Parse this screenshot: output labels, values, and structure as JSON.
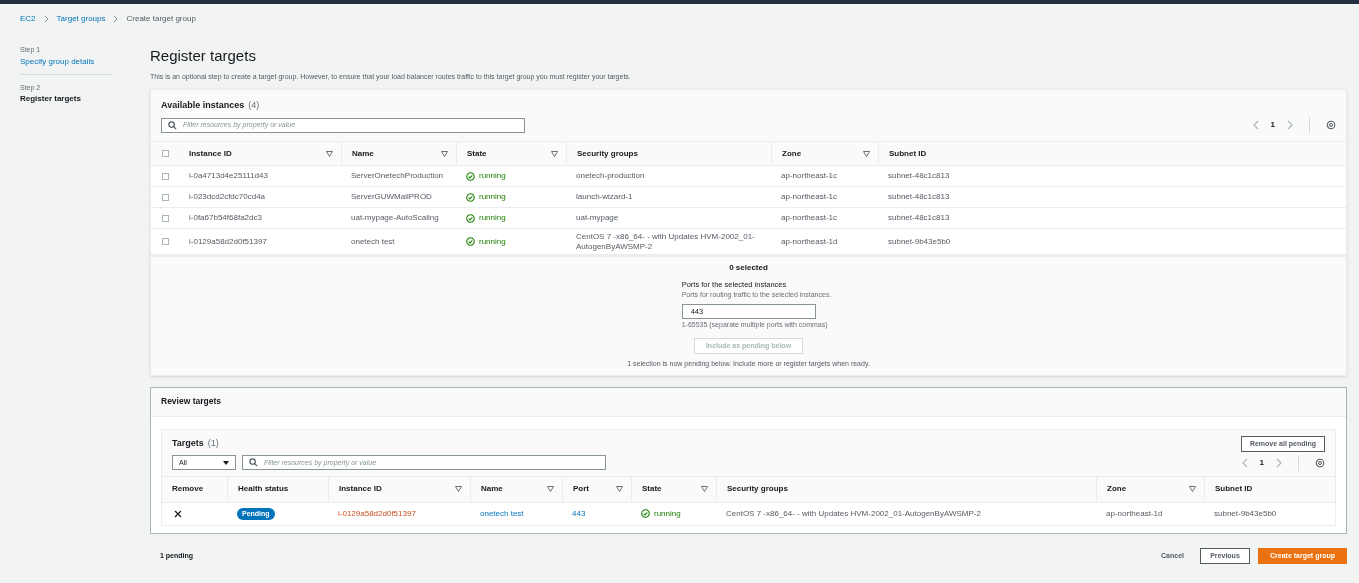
{
  "breadcrumb": [
    {
      "label": "EC2",
      "link": true
    },
    {
      "label": "Target groups",
      "link": true
    },
    {
      "label": "Create target group",
      "link": false
    }
  ],
  "steps": [
    {
      "step": "Step 1",
      "label": "Specify group details",
      "selected": false
    },
    {
      "step": "Step 2",
      "label": "Register targets",
      "selected": true
    }
  ],
  "title": "Register targets",
  "description": "This is an optional step to create a target group. However, to ensure that your load balancer routes traffic to this target group you must register your targets.",
  "available": {
    "title": "Available instances",
    "count": "(4)",
    "search_placeholder": "Filter resources by property or value",
    "page": "1",
    "columns": [
      {
        "label": "Instance ID",
        "sortable": true
      },
      {
        "label": "Name",
        "sortable": true
      },
      {
        "label": "State",
        "sortable": true
      },
      {
        "label": "Security groups",
        "sortable": false
      },
      {
        "label": "Zone",
        "sortable": true
      },
      {
        "label": "Subnet ID",
        "sortable": false
      }
    ],
    "all_checked": false,
    "rows": [
      {
        "checked": false,
        "instance_id": "i-0a4713d4e25111d43",
        "name": "ServerOnetechProduction",
        "state": "running",
        "security_groups": "onetech-production",
        "zone": "ap-northeast-1c",
        "subnet_id": "subnet-48c1c813"
      },
      {
        "checked": false,
        "instance_id": "i-023dcd2cfdc70cd4a",
        "name": "ServerGUWMailPROD",
        "state": "running",
        "security_groups": "launch-wizard-1",
        "zone": "ap-northeast-1c",
        "subnet_id": "subnet-48c1c813"
      },
      {
        "checked": false,
        "instance_id": "i-0fa67b54f68fa2dc3",
        "name": "uat-mypage-AutoScaling",
        "state": "running",
        "security_groups": "uat-mypage",
        "zone": "ap-northeast-1c",
        "subnet_id": "subnet-48c1c813"
      },
      {
        "checked": false,
        "instance_id": "i-0129a58d2d0f51397",
        "name": "onetech test",
        "state": "running",
        "security_groups": "CentOS 7 -x86_64- - with Updates HVM-2002_01-AutogenByAWSMP-2",
        "zone": "ap-northeast-1d",
        "subnet_id": "subnet-9b43e5b0"
      }
    ]
  },
  "selection": {
    "count_text": "0 selected",
    "ports_label": "Ports for the selected instances",
    "ports_hint": "Ports for routing traffic to the selected instances.",
    "ports_value": "443",
    "range_hint": "1-65535 (separate multiple ports with commas)",
    "include_button": {
      "label": "Include as pending below",
      "disabled": true
    },
    "pending_note": "1 selection is now pending below. Include more or register targets when ready."
  },
  "review": {
    "title": "Review targets",
    "targets_title": "Targets",
    "count": "(1)",
    "remove_all": "Remove all pending",
    "filter_value": "All",
    "search_placeholder": "Filter resources by property or value",
    "page": "1",
    "columns": [
      {
        "label": "Remove",
        "sortable": false
      },
      {
        "label": "Health status",
        "sortable": false
      },
      {
        "label": "Instance ID",
        "sortable": true
      },
      {
        "label": "Name",
        "sortable": true
      },
      {
        "label": "Port",
        "sortable": true
      },
      {
        "label": "State",
        "sortable": true
      },
      {
        "label": "Security groups",
        "sortable": false
      },
      {
        "label": "Zone",
        "sortable": true
      },
      {
        "label": "Subnet ID",
        "sortable": false
      }
    ],
    "rows": [
      {
        "health": "Pending",
        "instance_id": "i-0129a58d2d0f51397",
        "name": "onetech test",
        "port": "443",
        "state": "running",
        "security_groups": "CentOS 7 -x86_64- - with Updates HVM-2002_01-AutogenByAWSMP-2",
        "zone": "ap-northeast-1d",
        "subnet_id": "subnet-9b43e5b0"
      }
    ]
  },
  "footer": {
    "pending": "1 pending",
    "cancel": "Cancel",
    "previous": "Previous",
    "create": "Create target group"
  }
}
